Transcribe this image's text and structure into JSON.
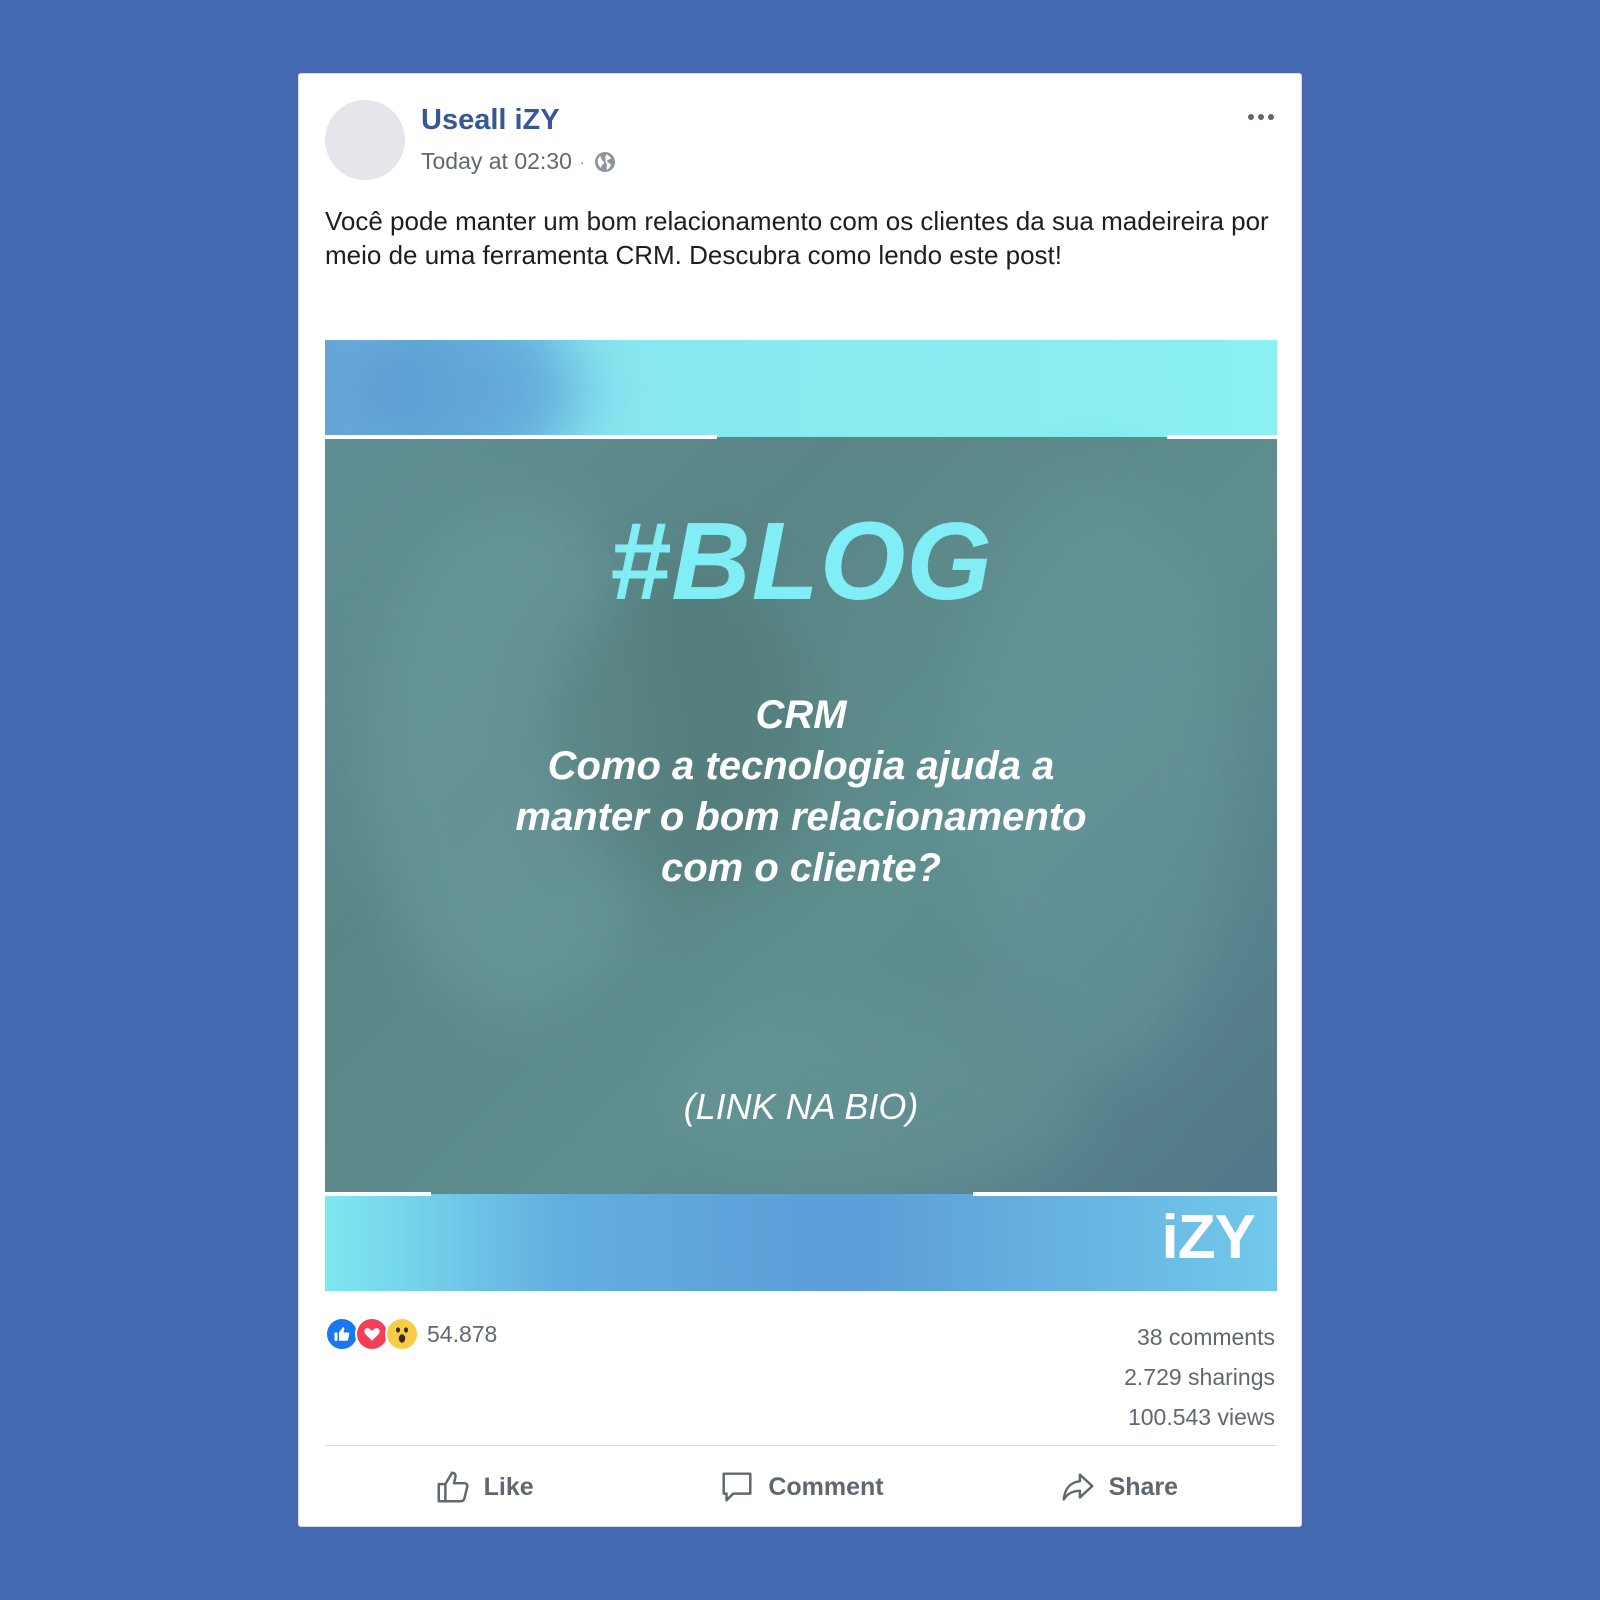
{
  "post": {
    "author": "Useall iZY",
    "time": "Today at 02:30",
    "separator": "·",
    "text": "Você pode manter um bom relacionamento com os clientes da sua madeireira por meio de uma ferramenta CRM. Descubra como lendo este post!"
  },
  "image": {
    "tag": "#BLOG",
    "headline_lines": [
      "CRM",
      "Como a tecnologia ajuda a",
      "manter o bom relacionamento",
      "com o cliente?"
    ],
    "cta": "(LINK NA BIO)",
    "logo": "iZY"
  },
  "engagement": {
    "reactions": [
      "like-icon",
      "love-icon",
      "wow-icon"
    ],
    "reaction_count": "54.878",
    "comments": "38 comments",
    "shares": "2.729 sharings",
    "views": "100.543 views"
  },
  "actions": {
    "like": "Like",
    "comment": "Comment",
    "share": "Share"
  },
  "colors": {
    "background": "#4569b1",
    "author": "#365899",
    "tag": "#80eef4"
  }
}
